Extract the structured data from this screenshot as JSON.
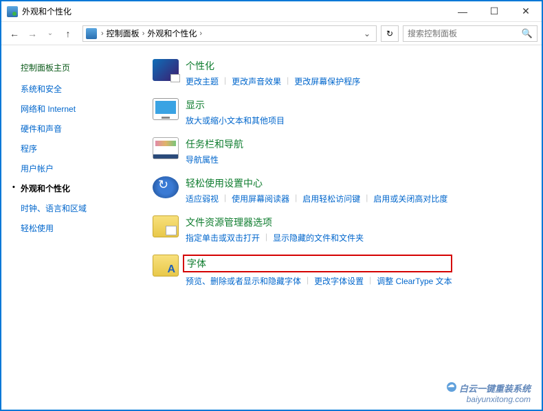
{
  "window": {
    "title": "外观和个性化"
  },
  "navbar": {
    "back_enabled": true,
    "forward_enabled": false,
    "breadcrumb": [
      "控制面板",
      "外观和个性化"
    ],
    "search_placeholder": "搜索控制面板"
  },
  "sidebar": {
    "title": "控制面板主页",
    "items": [
      "系统和安全",
      "网络和 Internet",
      "硬件和声音",
      "程序",
      "用户帐户",
      "外观和个性化",
      "时钟、语言和区域",
      "轻松使用"
    ],
    "active_index": 5
  },
  "categories": [
    {
      "icon": "personalization",
      "title": "个性化",
      "links": [
        "更改主题",
        "更改声音效果",
        "更改屏幕保护程序"
      ]
    },
    {
      "icon": "display",
      "title": "显示",
      "links": [
        "放大或缩小文本和其他项目"
      ]
    },
    {
      "icon": "taskbar",
      "title": "任务栏和导航",
      "links": [
        "导航属性"
      ]
    },
    {
      "icon": "ease",
      "title": "轻松使用设置中心",
      "links": [
        "适应弱视",
        "使用屏幕阅读器",
        "启用轻松访问键",
        "启用或关闭高对比度"
      ]
    },
    {
      "icon": "explorer",
      "title": "文件资源管理器选项",
      "links": [
        "指定单击或双击打开",
        "显示隐藏的文件和文件夹"
      ]
    },
    {
      "icon": "fonts",
      "title": "字体",
      "highlighted": true,
      "links": [
        "预览、删除或者显示和隐藏字体",
        "更改字体设置",
        "调整 ClearType 文本"
      ]
    }
  ],
  "watermark": {
    "line1": "白云一键重装系统",
    "line2": "baiyunxitong.com"
  }
}
